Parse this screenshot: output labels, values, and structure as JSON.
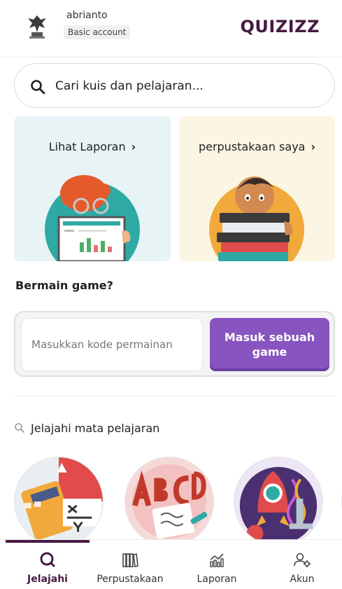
{
  "header": {
    "username": "abrianto",
    "account_type": "Basic account",
    "logo_text": "QUIZIZZ"
  },
  "search": {
    "placeholder": "Cari kuis dan pelajaran..."
  },
  "cards": {
    "report_label": "Lihat Laporan",
    "library_label": "perpustakaan saya",
    "chevron": "›"
  },
  "game": {
    "title": "Bermain game?",
    "code_placeholder": "Masukkan kode permainan",
    "join_label": "Masuk sebuah game"
  },
  "explore": {
    "title": "Jelajahi mata pelajaran",
    "subjects": [
      "math-subject",
      "english-subject",
      "science-subject"
    ]
  },
  "tabs": [
    {
      "label": "Jelajahi",
      "icon": "explore-icon",
      "active": true
    },
    {
      "label": "Perpustakaan",
      "icon": "library-icon",
      "active": false
    },
    {
      "label": "Laporan",
      "icon": "chart-icon",
      "active": false
    },
    {
      "label": "Akun",
      "icon": "account-icon",
      "active": false
    }
  ],
  "colors": {
    "brand": "#461a42",
    "accent": "#8854c0",
    "report_card_bg": "#e8f3f5",
    "library_card_bg": "#fbf5e3"
  }
}
